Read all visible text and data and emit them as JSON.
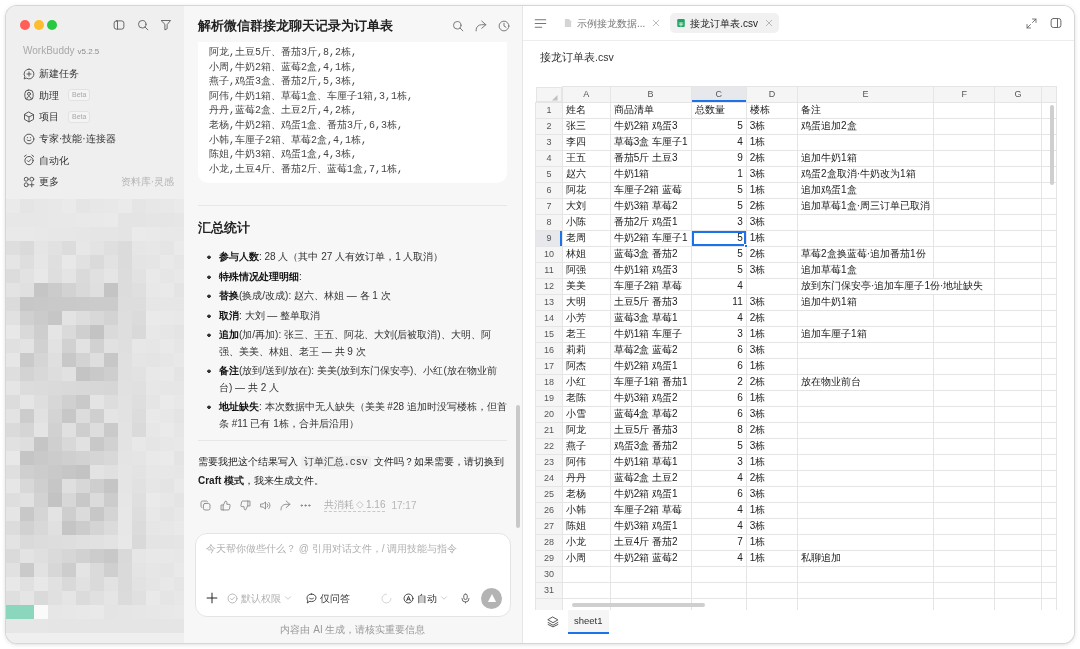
{
  "sidebar": {
    "app_name": "WorkBuddy",
    "version": "v5.2.5",
    "items": [
      {
        "label": "新建任务",
        "selected": false
      },
      {
        "label": "助理",
        "badge": "Beta",
        "selected": false
      },
      {
        "label": "项目",
        "badge": "Beta",
        "selected": false
      },
      {
        "label": "专家·技能·连接器",
        "selected": false
      },
      {
        "label": "自动化",
        "selected": false
      },
      {
        "label": "更多",
        "note": "资料库·灵感",
        "selected": false
      }
    ]
  },
  "chat": {
    "title": "解析微信群接龙聊天记录为订单表",
    "code_lines": [
      "阿龙,土豆5斤、番茄3斤,8,2栋,",
      "小周,牛奶2箱、蓝莓2盒,4,1栋,",
      "燕子,鸡蛋3盒、番茄2斤,5,3栋,",
      "阿伟,牛奶1箱、草莓1盒、车厘子1箱,3,1栋,",
      "丹丹,蓝莓2盒、土豆2斤,4,2栋,",
      "老杨,牛奶2箱、鸡蛋1盒、番茄3斤,6,3栋,",
      "小韩,车厘子2箱、草莓2盒,4,1栋,",
      "陈姐,牛奶3箱、鸡蛋1盒,4,3栋,",
      "小龙,土豆4斤、番茄2斤、蓝莓1盒,7,1栋,"
    ],
    "summary": {
      "heading": "汇总统计",
      "items": [
        "**参与人数**: 28 人（其中 27 人有效订单，1 人取消）",
        "**特殊情况处理明细**:",
        "**替换**(换成/改成): 赵六、林姐 — 各 1 次",
        "**取消**: 大刘 — 整单取消",
        "**追加**(加/再加): 张三、王五、阿花、大刘(后被取消)、大明、阿强、美美、林姐、老王 — 共 9 次",
        "**备注**(放到/送到/放在): 美美(放到东门保安亭)、小红(放在物业前台) — 共 2 人",
        "**地址缺失**: 本次数据中无人缺失（美美 #28 追加时没写楼栋，但首条 #11 已有 1栋，合并后沿用）"
      ]
    },
    "reply": [
      {
        "kind": "text",
        "text": "需要我把这个结果写入 "
      },
      {
        "kind": "code",
        "text": "订单汇总.csv"
      },
      {
        "kind": "text",
        "text": " 文件吗？如果需要，请切换到 **Craft 模式**，我来生成文件。"
      }
    ],
    "usage": {
      "label": "共消耗",
      "cost": "1.16",
      "time": "17:17"
    },
    "composer": {
      "placeholder": "今天帮你做些什么？ @ 引用对话文件，/ 调用技能与指令",
      "permission": {
        "label": "默认权限",
        "disabled": true
      },
      "mode": "仅问答",
      "model": "自动",
      "send_disabled": true
    },
    "disclaimer": "内容由 AI 生成，请核实重要信息"
  },
  "viewer": {
    "tabs": [
      {
        "kind": "document",
        "label": "示例接龙数据...",
        "selected": false
      },
      {
        "kind": "spreadsheet",
        "label": "接龙订单表.csv",
        "selected": true
      }
    ],
    "file_title": "接龙订单表.csv",
    "sheet": {
      "columns": [
        {
          "label": "A",
          "kind": "text",
          "selected": false
        },
        {
          "label": "B",
          "kind": "text",
          "selected": false
        },
        {
          "label": "C",
          "kind": "number",
          "selected": true
        },
        {
          "label": "D",
          "kind": "text",
          "selected": false
        },
        {
          "label": "E",
          "kind": "text",
          "selected": false
        },
        {
          "label": "F",
          "kind": "text",
          "selected": false
        },
        {
          "label": "G",
          "kind": "text",
          "selected": false
        }
      ],
      "rows": [
        {
          "number": "1",
          "kind": "header",
          "selected": false,
          "cells": {
            "A": "姓名",
            "B": "商品清单",
            "C": "总数量",
            "D": "楼栋",
            "E": "备注"
          }
        },
        {
          "number": "2",
          "kind": "data",
          "selected": false,
          "cells": {
            "A": "张三",
            "B": "牛奶2箱 鸡蛋3",
            "C": "5",
            "D": "3栋",
            "E": "鸡蛋追加2盒"
          }
        },
        {
          "number": "3",
          "kind": "data",
          "selected": false,
          "cells": {
            "A": "李四",
            "B": "草莓3盒 车厘子1",
            "C": "4",
            "D": "1栋"
          }
        },
        {
          "number": "4",
          "kind": "data",
          "selected": false,
          "cells": {
            "A": "王五",
            "B": "番茄5斤 土豆3",
            "C": "9",
            "D": "2栋",
            "E": "追加牛奶1箱"
          }
        },
        {
          "number": "5",
          "kind": "data",
          "selected": false,
          "cells": {
            "A": "赵六",
            "B": "牛奶1箱",
            "C": "1",
            "D": "3栋",
            "E": "鸡蛋2盒取消·牛奶改为1箱"
          }
        },
        {
          "number": "6",
          "kind": "data",
          "selected": false,
          "cells": {
            "A": "阿花",
            "B": "车厘子2箱 蓝莓",
            "C": "5",
            "D": "1栋",
            "E": "追加鸡蛋1盒"
          }
        },
        {
          "number": "7",
          "kind": "data",
          "selected": false,
          "cells": {
            "A": "大刘",
            "B": "牛奶3箱 草莓2",
            "C": "5",
            "D": "2栋",
            "E": "追加草莓1盒·周三订单已取消"
          }
        },
        {
          "number": "8",
          "kind": "data",
          "selected": false,
          "cells": {
            "A": "小陈",
            "B": "番茄2斤 鸡蛋1",
            "C": "3",
            "D": "3栋"
          }
        },
        {
          "number": "9",
          "kind": "data",
          "selected": true,
          "cells": {
            "A": "老周",
            "B": "牛奶2箱 车厘子1",
            "C": "5",
            "D": "1栋"
          }
        },
        {
          "number": "10",
          "kind": "data",
          "selected": false,
          "cells": {
            "A": "林姐",
            "B": "蓝莓3盒 番茄2",
            "C": "5",
            "D": "2栋",
            "E": "草莓2盒换蓝莓·追加番茄1份"
          }
        },
        {
          "number": "11",
          "kind": "data",
          "selected": false,
          "cells": {
            "A": "阿强",
            "B": "牛奶1箱 鸡蛋3",
            "C": "5",
            "D": "3栋",
            "E": "追加草莓1盒"
          }
        },
        {
          "number": "12",
          "kind": "data",
          "selected": false,
          "cells": {
            "A": "美美",
            "B": "车厘子2箱 草莓",
            "C": "4",
            "E": "放到东门保安亭·追加车厘子1份·地址缺失"
          }
        },
        {
          "number": "13",
          "kind": "data",
          "selected": false,
          "cells": {
            "A": "大明",
            "B": "土豆5斤 番茄3",
            "C": "11",
            "D": "3栋",
            "E": "追加牛奶1箱"
          }
        },
        {
          "number": "14",
          "kind": "data",
          "selected": false,
          "cells": {
            "A": "小芳",
            "B": "蓝莓3盒 草莓1",
            "C": "4",
            "D": "2栋"
          }
        },
        {
          "number": "15",
          "kind": "data",
          "selected": false,
          "cells": {
            "A": "老王",
            "B": "牛奶1箱 车厘子",
            "C": "3",
            "D": "1栋",
            "E": "追加车厘子1箱"
          }
        },
        {
          "number": "16",
          "kind": "data",
          "selected": false,
          "cells": {
            "A": "莉莉",
            "B": "草莓2盒 蓝莓2",
            "C": "6",
            "D": "3栋"
          }
        },
        {
          "number": "17",
          "kind": "data",
          "selected": false,
          "cells": {
            "A": "阿杰",
            "B": "牛奶2箱 鸡蛋1",
            "C": "6",
            "D": "1栋"
          }
        },
        {
          "number": "18",
          "kind": "data",
          "selected": false,
          "cells": {
            "A": "小红",
            "B": "车厘子1箱 番茄1",
            "C": "2",
            "D": "2栋",
            "E": "放在物业前台"
          }
        },
        {
          "number": "19",
          "kind": "data",
          "selected": false,
          "cells": {
            "A": "老陈",
            "B": "牛奶3箱 鸡蛋2",
            "C": "6",
            "D": "1栋"
          }
        },
        {
          "number": "20",
          "kind": "data",
          "selected": false,
          "cells": {
            "A": "小雪",
            "B": "蓝莓4盒 草莓2",
            "C": "6",
            "D": "3栋"
          }
        },
        {
          "number": "21",
          "kind": "data",
          "selected": false,
          "cells": {
            "A": "阿龙",
            "B": "土豆5斤 番茄3",
            "C": "8",
            "D": "2栋"
          }
        },
        {
          "number": "22",
          "kind": "data",
          "selected": false,
          "cells": {
            "A": "燕子",
            "B": "鸡蛋3盒 番茄2",
            "C": "5",
            "D": "3栋"
          }
        },
        {
          "number": "23",
          "kind": "data",
          "selected": false,
          "cells": {
            "A": "阿伟",
            "B": "牛奶1箱 草莓1",
            "C": "3",
            "D": "1栋"
          }
        },
        {
          "number": "24",
          "kind": "data",
          "selected": false,
          "cells": {
            "A": "丹丹",
            "B": "蓝莓2盒 土豆2",
            "C": "4",
            "D": "2栋"
          }
        },
        {
          "number": "25",
          "kind": "data",
          "selected": false,
          "cells": {
            "A": "老杨",
            "B": "牛奶2箱 鸡蛋1",
            "C": "6",
            "D": "3栋"
          }
        },
        {
          "number": "26",
          "kind": "data",
          "selected": false,
          "cells": {
            "A": "小韩",
            "B": "车厘子2箱 草莓",
            "C": "4",
            "D": "1栋"
          }
        },
        {
          "number": "27",
          "kind": "data",
          "selected": false,
          "cells": {
            "A": "陈姐",
            "B": "牛奶3箱 鸡蛋1",
            "C": "4",
            "D": "3栋"
          }
        },
        {
          "number": "28",
          "kind": "data",
          "selected": false,
          "cells": {
            "A": "小龙",
            "B": "土豆4斤 番茄2",
            "C": "7",
            "D": "1栋"
          }
        },
        {
          "number": "29",
          "kind": "data",
          "selected": false,
          "cells": {
            "A": "小周",
            "B": "牛奶2箱 蓝莓2",
            "C": "4",
            "D": "1栋",
            "E": "私聊追加"
          }
        },
        {
          "number": "30",
          "kind": "data",
          "selected": false
        },
        {
          "number": "31",
          "kind": "data",
          "selected": false
        }
      ]
    },
    "sheet_tabs": [
      {
        "label": "sheet1",
        "selected": true
      }
    ]
  }
}
